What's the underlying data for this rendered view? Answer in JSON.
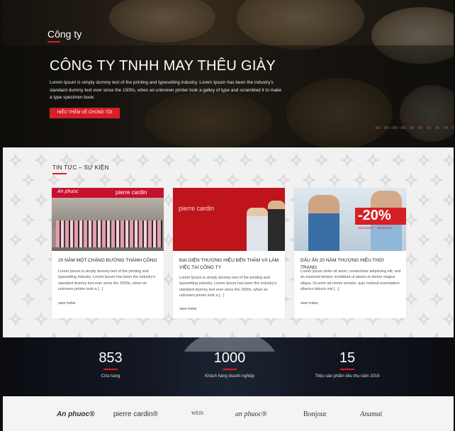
{
  "hero": {
    "page_label": "Công ty",
    "title": "CÔNG TY TNHH MAY THÊU GIÀY",
    "description": "Lorem Ipsum is simply dummy text of the printing and typesetting industry. Lorem Ipsum has been the industry's standard dummy text ever since the 1500s, when an unknown printer took a galley of type and scrambled it to make a type specimen book.",
    "button_label": "HIỂU THÊM VỀ CHÚNG TÔI"
  },
  "news": {
    "section_title": "TIN TỨC – SỰ KIỆN",
    "cards": [
      {
        "image_brand_left": "An phuoc",
        "image_brand_right": "pierre cardin",
        "title": "20 NĂM MỘT CHẶNG ĐƯỜNG THÀNH CÔNG",
        "excerpt": "Lorem Ipsum is simply dummy text of the printing and typesetting industry. Lorem Ipsum has been the industry's standard dummy text ever since the 1500s, when an unknown printer took a [...]",
        "more_label": "XEM THÊM"
      },
      {
        "image_brand_left": "pierre cardin",
        "title": "ĐẠI DIỆN THƯƠNG HIỆU ĐẾN THĂM VÀ LÀM VIỆC TẠI CÔNG TY",
        "excerpt": "Lorem Ipsum is simply dummy text of the printing and typesetting industry. Lorem Ipsum has been the industry's standard dummy text ever since the 1500s, when an unknown printer took a [...]",
        "more_label": "XEM THÊM"
      },
      {
        "image_badge": "-20%",
        "image_dates": "15/12/2017 - 16/12/2017",
        "title": "DẤU ẤN 20 NĂM THƯƠNG HIỆU THỜI TRANG",
        "excerpt": "Lorem ipsum dolor sit amet, consectetur adipiscing elit, sed do eiusmod tempor incididunt ut labore et dolore magna aliqua. Ut enim ad minim veniam, quis nostrud exercitation ullamco laboris nisi [...]",
        "more_label": "XEM THÊM"
      }
    ]
  },
  "stats": [
    {
      "value": "853",
      "label": "Cửa hàng"
    },
    {
      "value": "1000",
      "label": "Khách hàng doanh nghiệp"
    },
    {
      "value": "15",
      "label": "Triệu sản phẩm tiêu thụ năm 2016"
    }
  ],
  "brands": [
    "An phuoc®",
    "pierre cardin®",
    "WEIS",
    "an phuoc®",
    "Bonjour",
    "Anamai"
  ],
  "colors": {
    "accent": "#d61f26",
    "stats_bg": "#121722",
    "news_bg": "#f1f1f1"
  }
}
